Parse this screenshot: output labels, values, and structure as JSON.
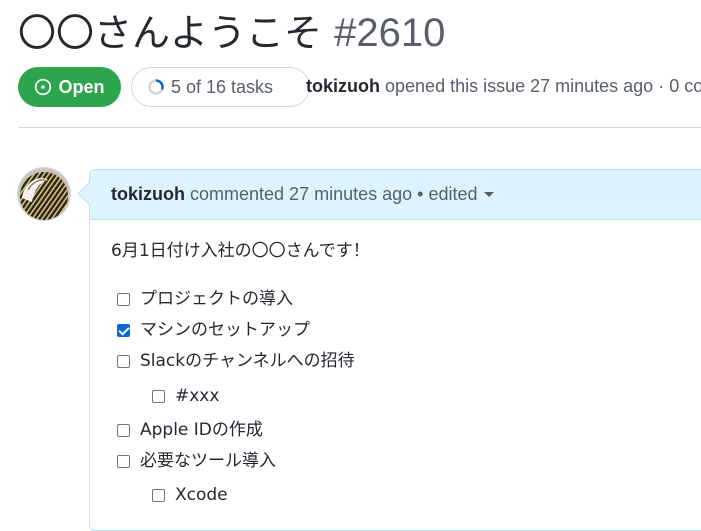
{
  "issue": {
    "title": "〇〇さんようこそ",
    "number": "#2610",
    "state": "Open",
    "tasks_progress": "5 of 16 tasks",
    "tasks_completed_fraction": 0.3125,
    "author": "tokizuoh",
    "opened_text": "opened this issue 27 minutes ago · 0 co"
  },
  "colors": {
    "open_green": "#2da44e",
    "accent_blue": "#0969da",
    "comment_header_bg": "#ddf4ff"
  },
  "comment": {
    "author": "tokizuoh",
    "meta_text": "commented 27 minutes ago • edited",
    "intro": "6月1日付け入社の〇〇さんです！",
    "tasks": [
      {
        "label": "プロジェクトの導入",
        "checked": false
      },
      {
        "label": "マシンのセットアップ",
        "checked": true
      },
      {
        "label": "Slackのチャンネルへの招待",
        "checked": false
      },
      {
        "label": "#xxx",
        "checked": false
      },
      {
        "label": "Apple IDの作成",
        "checked": false
      },
      {
        "label": "必要なツール導入",
        "checked": false
      },
      {
        "label": "Xcode",
        "checked": false
      }
    ]
  }
}
